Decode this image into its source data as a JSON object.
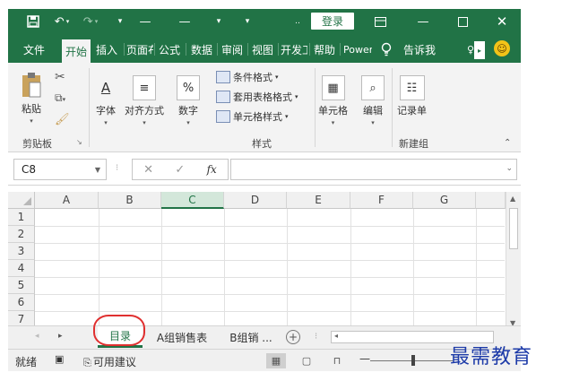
{
  "titlebar": {
    "login_label": "登录",
    "accent_color": "#217346",
    "icons": [
      "save-icon",
      "undo-icon",
      "redo-icon",
      "customize-icon",
      "ribbon-display-icon",
      "minimize-icon",
      "maximize-icon",
      "close-icon"
    ]
  },
  "tabs": [
    {
      "label": "文件"
    },
    {
      "label": "开始",
      "active": true
    },
    {
      "label": "插入"
    },
    {
      "label": "页面布局"
    },
    {
      "label": "公式"
    },
    {
      "label": "数据"
    },
    {
      "label": "审阅"
    },
    {
      "label": "视图"
    },
    {
      "label": "开发工具"
    },
    {
      "label": "帮助"
    },
    {
      "label": "Power Pivot"
    },
    {
      "label": "告诉我"
    }
  ],
  "ribbon": {
    "clipboard": {
      "paste": "粘贴",
      "group": "剪贴板"
    },
    "font": "字体",
    "alignment": "对齐方式",
    "number": "数字",
    "styles": {
      "conditional": "条件格式",
      "table": "套用表格格式",
      "cell_style": "单元格样式",
      "group": "样式"
    },
    "cells": "单元格",
    "editing": "编辑",
    "record": {
      "label": "记录单",
      "group": "新建组"
    }
  },
  "formula_bar": {
    "name_box": "C8",
    "fx": "fx",
    "value": ""
  },
  "grid": {
    "columns": [
      "A",
      "B",
      "C",
      "D",
      "E",
      "F",
      "G"
    ],
    "rows": [
      "1",
      "2",
      "3",
      "4",
      "5",
      "6",
      "7"
    ],
    "selected_column": "C"
  },
  "sheets": {
    "tabs": [
      "目录",
      "A组销售表",
      "B组销 ..."
    ],
    "active": "目录",
    "add": "+"
  },
  "status": {
    "ready": "就绪",
    "accessibility": "可用建议"
  },
  "watermark": "最需教育"
}
